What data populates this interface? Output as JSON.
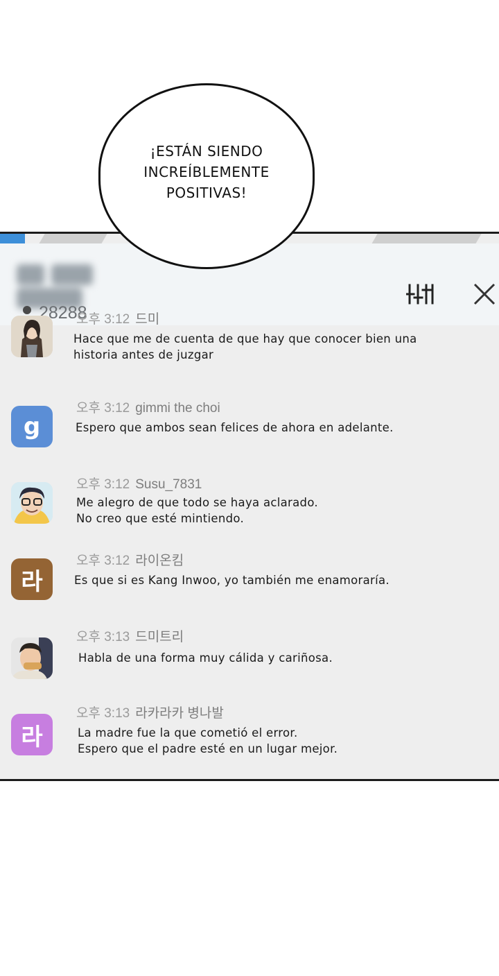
{
  "speech_bubble": {
    "text": "¡ESTÁN SIENDO\nINCREÍBLEMENTE\nPOSITIVAS!"
  },
  "chat_panel": {
    "viewer_count": "28288",
    "accent_color": "#3d8fd9",
    "icons": {
      "viewers": "person-icon",
      "settings": "sliders-icon",
      "close": "close-icon"
    },
    "messages": [
      {
        "time": "오후 3:12",
        "nickname": "드미",
        "avatar": {
          "type": "image",
          "description": "woman-portrait"
        },
        "lines": [
          "Hace que me de cuenta de que hay que conocer bien una",
          "historia antes de juzgar"
        ]
      },
      {
        "time": "오후 3:12",
        "nickname": "gimmi the choi",
        "avatar": {
          "type": "letter",
          "letter": "g",
          "color": "#5b8ed6"
        },
        "lines": [
          "Espero que ambos sean felices de ahora en adelante."
        ]
      },
      {
        "time": "오후 3:12",
        "nickname": "Susu_7831",
        "avatar": {
          "type": "image",
          "description": "cartoon-man-glasses"
        },
        "lines": [
          "Me alegro de que todo se haya aclarado.",
          "No creo que esté mintiendo."
        ]
      },
      {
        "time": "오후 3:12",
        "nickname": "라이온킴",
        "avatar": {
          "type": "letter",
          "letter": "라",
          "color": "#946434"
        },
        "lines": [
          "Es que si es Kang Inwoo, yo también me enamoraría."
        ]
      },
      {
        "time": "오후 3:13",
        "nickname": "드미트리",
        "avatar": {
          "type": "image",
          "description": "man-eating"
        },
        "lines": [
          "Habla de una forma muy cálida y cariñosa."
        ]
      },
      {
        "time": "오후 3:13",
        "nickname": "라카라카 병나발",
        "avatar": {
          "type": "letter",
          "letter": "라",
          "color": "#c77ee0"
        },
        "lines": [
          "La madre fue la que cometió el error.",
          "Espero que el padre esté en un lugar mejor."
        ]
      }
    ]
  }
}
